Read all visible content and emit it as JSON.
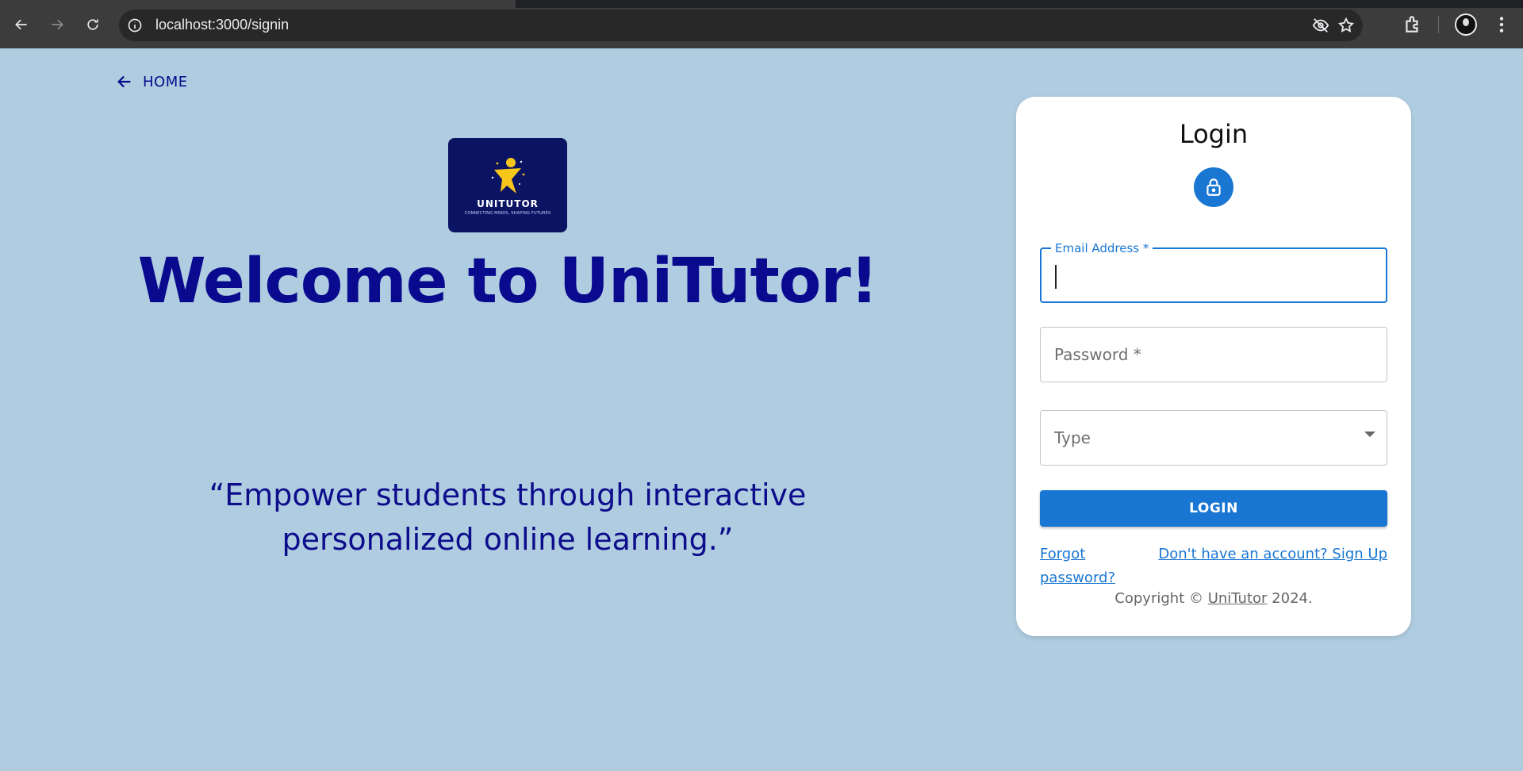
{
  "browser": {
    "url": "localhost:3000/signin"
  },
  "page": {
    "home_label": "HOME",
    "logo": {
      "name": "UNITUTOR",
      "tagline": "CONNECTING MINDS, SHAPING FUTURES"
    },
    "welcome": "Welcome to UniTutor!",
    "quote_line1": "“Empower students through interactive",
    "quote_line2": "personalized online learning.”"
  },
  "login_card": {
    "title": "Login",
    "email_label": "Email Address *",
    "email_value": "",
    "password_placeholder": "Password *",
    "type_placeholder": "Type",
    "login_button": "LOGIN",
    "forgot_password": "Forgot password?",
    "signup_link": "Don't have an account? Sign Up",
    "copyright_prefix": "Copyright ©",
    "copyright_brand": "UniTutor",
    "copyright_year": "2024."
  },
  "colors": {
    "background": "#afcce0",
    "primary": "#1976d2",
    "heading": "#0a0a8f",
    "logo_bg": "#0b1463"
  }
}
